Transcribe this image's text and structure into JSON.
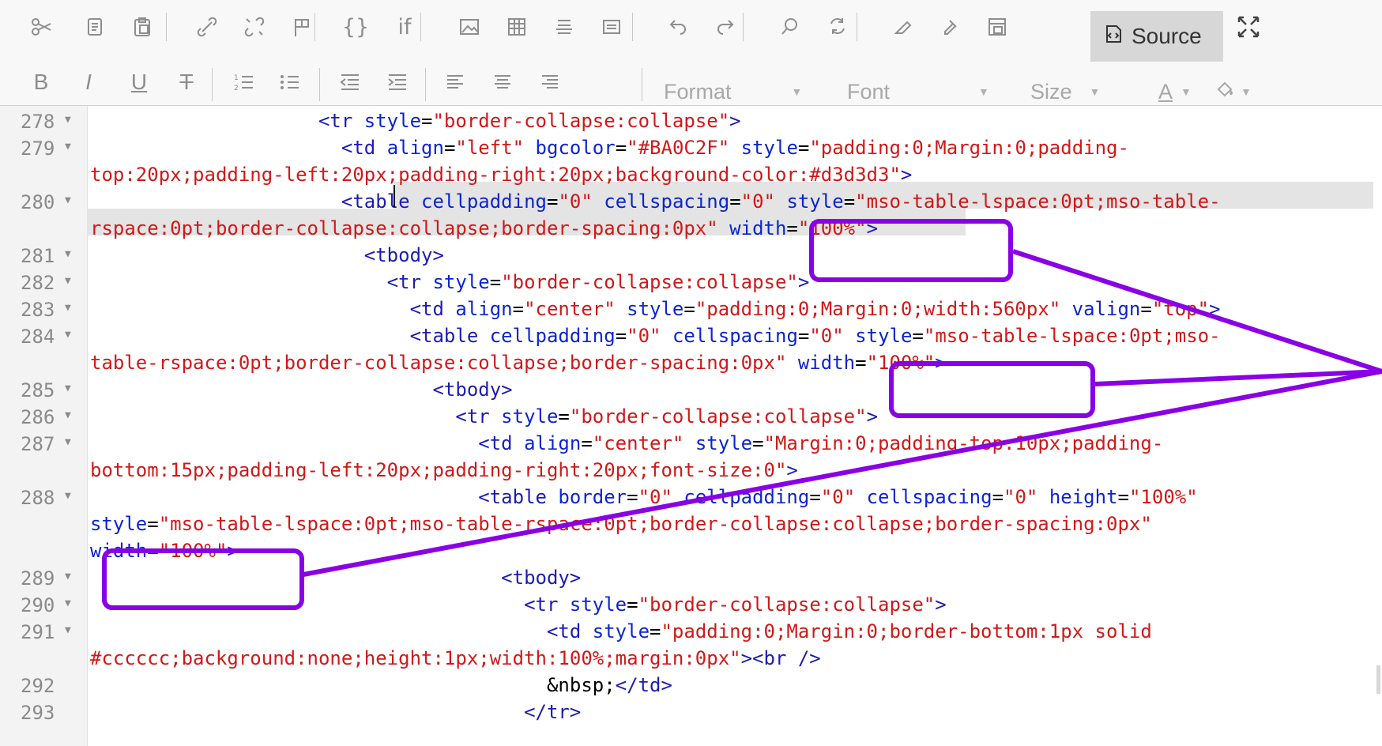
{
  "toolbar": {
    "row1": [
      {
        "icon": "cut-icon"
      },
      {
        "icon": "copy-icon"
      },
      {
        "icon": "paste-icon"
      },
      {
        "icon": "link-icon"
      },
      {
        "icon": "unlink-icon"
      },
      {
        "icon": "anchor-icon"
      },
      {
        "icon": "braces-icon",
        "text": "{}"
      },
      {
        "icon": "if-icon",
        "text": "if"
      },
      {
        "icon": "image-icon"
      },
      {
        "icon": "table-icon"
      },
      {
        "icon": "horizontal-rule-icon"
      },
      {
        "icon": "special-char-icon"
      },
      {
        "icon": "undo-icon"
      },
      {
        "icon": "redo-icon"
      },
      {
        "icon": "find-icon"
      },
      {
        "icon": "replace-icon"
      },
      {
        "icon": "remove-format-icon"
      },
      {
        "icon": "copy-format-icon"
      },
      {
        "icon": "show-blocks-icon"
      }
    ],
    "source_label": "Source",
    "maximize_icon": "maximize-icon",
    "row2": [
      {
        "icon": "bold-icon",
        "text": "B"
      },
      {
        "icon": "italic-icon",
        "text": "I"
      },
      {
        "icon": "underline-icon",
        "text": "U"
      },
      {
        "icon": "strike-icon",
        "text": "T"
      },
      {
        "icon": "numbered-list-icon"
      },
      {
        "icon": "bulleted-list-icon"
      },
      {
        "icon": "outdent-icon"
      },
      {
        "icon": "indent-icon"
      },
      {
        "icon": "align-left-icon"
      },
      {
        "icon": "align-center-icon"
      },
      {
        "icon": "align-right-icon"
      }
    ],
    "format_label": "Format",
    "font_label": "Font",
    "size_label": "Size",
    "text_color_label": "A",
    "bg_color_icon": "paint-bucket-icon"
  },
  "gutter": [
    {
      "num": "278",
      "fold": true
    },
    {
      "num": "279",
      "fold": true
    },
    {
      "num": "280",
      "fold": true
    },
    {
      "num": "281",
      "fold": true
    },
    {
      "num": "282",
      "fold": true
    },
    {
      "num": "283",
      "fold": true
    },
    {
      "num": "284",
      "fold": true
    },
    {
      "num": "285",
      "fold": true
    },
    {
      "num": "286",
      "fold": true
    },
    {
      "num": "287",
      "fold": true
    },
    {
      "num": "288",
      "fold": true
    },
    {
      "num": "289",
      "fold": true
    },
    {
      "num": "290",
      "fold": true
    },
    {
      "num": "291",
      "fold": true
    },
    {
      "num": "292",
      "fold": false
    },
    {
      "num": "293",
      "fold": false
    }
  ],
  "lines": [
    [
      [
        "p",
        "                    <tr "
      ],
      [
        "a",
        "style"
      ],
      [
        "e",
        "="
      ],
      [
        "v",
        "\"border-collapse:collapse\""
      ],
      [
        "p",
        ">"
      ]
    ],
    [
      [
        "p",
        "                      <td "
      ],
      [
        "a",
        "align"
      ],
      [
        "e",
        "="
      ],
      [
        "v",
        "\"left\""
      ],
      [
        "p",
        " "
      ],
      [
        "a",
        "bgcolor"
      ],
      [
        "e",
        "="
      ],
      [
        "v",
        "\"#BA0C2F\""
      ],
      [
        "p",
        " "
      ],
      [
        "a",
        "style"
      ],
      [
        "e",
        "="
      ],
      [
        "v",
        "\"padding:0;Margin:0;padding-"
      ]
    ],
    [
      [
        "v",
        "top:20px;padding-left:20px;padding-right:20px;background-color:#d3d3d3\""
      ],
      [
        "p",
        ">"
      ]
    ],
    [
      [
        "p",
        "                      <table "
      ],
      [
        "a",
        "cellpadding"
      ],
      [
        "e",
        "="
      ],
      [
        "v",
        "\"0\""
      ],
      [
        "p",
        " "
      ],
      [
        "a",
        "cellspacing"
      ],
      [
        "e",
        "="
      ],
      [
        "v",
        "\"0\""
      ],
      [
        "p",
        " "
      ],
      [
        "a",
        "style"
      ],
      [
        "e",
        "="
      ],
      [
        "v",
        "\"mso-table-lspace:0pt;mso-table-"
      ]
    ],
    [
      [
        "v",
        "rspace:0pt;border-collapse:collapse;border-spacing:0px\""
      ],
      [
        "p",
        " "
      ],
      [
        "a",
        "width"
      ],
      [
        "e",
        "="
      ],
      [
        "v",
        "\"100%\""
      ],
      [
        "p",
        ">"
      ]
    ],
    [
      [
        "p",
        "                        <tbody>"
      ]
    ],
    [
      [
        "p",
        "                          <tr "
      ],
      [
        "a",
        "style"
      ],
      [
        "e",
        "="
      ],
      [
        "v",
        "\"border-collapse:collapse\""
      ],
      [
        "p",
        ">"
      ]
    ],
    [
      [
        "p",
        "                            <td "
      ],
      [
        "a",
        "align"
      ],
      [
        "e",
        "="
      ],
      [
        "v",
        "\"center\""
      ],
      [
        "p",
        " "
      ],
      [
        "a",
        "style"
      ],
      [
        "e",
        "="
      ],
      [
        "v",
        "\"padding:0;Margin:0;width:560px\""
      ],
      [
        "p",
        " "
      ],
      [
        "a",
        "valign"
      ],
      [
        "e",
        "="
      ],
      [
        "v",
        "\"top\""
      ],
      [
        "p",
        ">"
      ]
    ],
    [
      [
        "p",
        "                            <table "
      ],
      [
        "a",
        "cellpadding"
      ],
      [
        "e",
        "="
      ],
      [
        "v",
        "\"0\""
      ],
      [
        "p",
        " "
      ],
      [
        "a",
        "cellspacing"
      ],
      [
        "e",
        "="
      ],
      [
        "v",
        "\"0\""
      ],
      [
        "p",
        " "
      ],
      [
        "a",
        "style"
      ],
      [
        "e",
        "="
      ],
      [
        "v",
        "\"mso-table-lspace:0pt;mso-"
      ]
    ],
    [
      [
        "v",
        "table-rspace:0pt;border-collapse:collapse;border-spacing:0px\""
      ],
      [
        "p",
        " "
      ],
      [
        "a",
        "width"
      ],
      [
        "e",
        "="
      ],
      [
        "v",
        "\"100%\""
      ],
      [
        "p",
        ">"
      ]
    ],
    [
      [
        "p",
        "                              <tbody>"
      ]
    ],
    [
      [
        "p",
        "                                <tr "
      ],
      [
        "a",
        "style"
      ],
      [
        "e",
        "="
      ],
      [
        "v",
        "\"border-collapse:collapse\""
      ],
      [
        "p",
        ">"
      ]
    ],
    [
      [
        "p",
        "                                  <td "
      ],
      [
        "a",
        "align"
      ],
      [
        "e",
        "="
      ],
      [
        "v",
        "\"center\""
      ],
      [
        "p",
        " "
      ],
      [
        "a",
        "style"
      ],
      [
        "e",
        "="
      ],
      [
        "v",
        "\"Margin:0;padding-top:10px;padding-"
      ]
    ],
    [
      [
        "v",
        "bottom:15px;padding-left:20px;padding-right:20px;font-size:0\""
      ],
      [
        "p",
        ">"
      ]
    ],
    [
      [
        "p",
        "                                  <table "
      ],
      [
        "a",
        "border"
      ],
      [
        "e",
        "="
      ],
      [
        "v",
        "\"0\""
      ],
      [
        "p",
        " "
      ],
      [
        "a",
        "cellpadding"
      ],
      [
        "e",
        "="
      ],
      [
        "v",
        "\"0\""
      ],
      [
        "p",
        " "
      ],
      [
        "a",
        "cellspacing"
      ],
      [
        "e",
        "="
      ],
      [
        "v",
        "\"0\""
      ],
      [
        "p",
        " "
      ],
      [
        "a",
        "height"
      ],
      [
        "e",
        "="
      ],
      [
        "v",
        "\"100%\""
      ]
    ],
    [
      [
        "a",
        "style"
      ],
      [
        "e",
        "="
      ],
      [
        "v",
        "\"mso-table-lspace:0pt;mso-table-rspace:0pt;border-collapse:collapse;border-spacing:0px\""
      ]
    ],
    [
      [
        "a",
        "width"
      ],
      [
        "e",
        "="
      ],
      [
        "v",
        "\"100%\""
      ],
      [
        "p",
        ">"
      ]
    ],
    [
      [
        "p",
        "                                    <tbody>"
      ]
    ],
    [
      [
        "p",
        "                                      <tr "
      ],
      [
        "a",
        "style"
      ],
      [
        "e",
        "="
      ],
      [
        "v",
        "\"border-collapse:collapse\""
      ],
      [
        "p",
        ">"
      ]
    ],
    [
      [
        "p",
        "                                        <td "
      ],
      [
        "a",
        "style"
      ],
      [
        "e",
        "="
      ],
      [
        "v",
        "\"padding:0;Margin:0;border-bottom:1px solid"
      ]
    ],
    [
      [
        "v",
        "#cccccc;background:none;height:1px;width:100%;margin:0px\""
      ],
      [
        "p",
        "><br />"
      ]
    ],
    [
      [
        "e",
        "                                        &nbsp;"
      ],
      [
        "p",
        "</td>"
      ]
    ],
    [
      [
        "p",
        "                                      </tr>"
      ]
    ]
  ],
  "colors": {
    "annotation": "#8a00e6",
    "tag": "#1c1cb5",
    "attr": "#0b25cf",
    "value": "#d11818"
  }
}
